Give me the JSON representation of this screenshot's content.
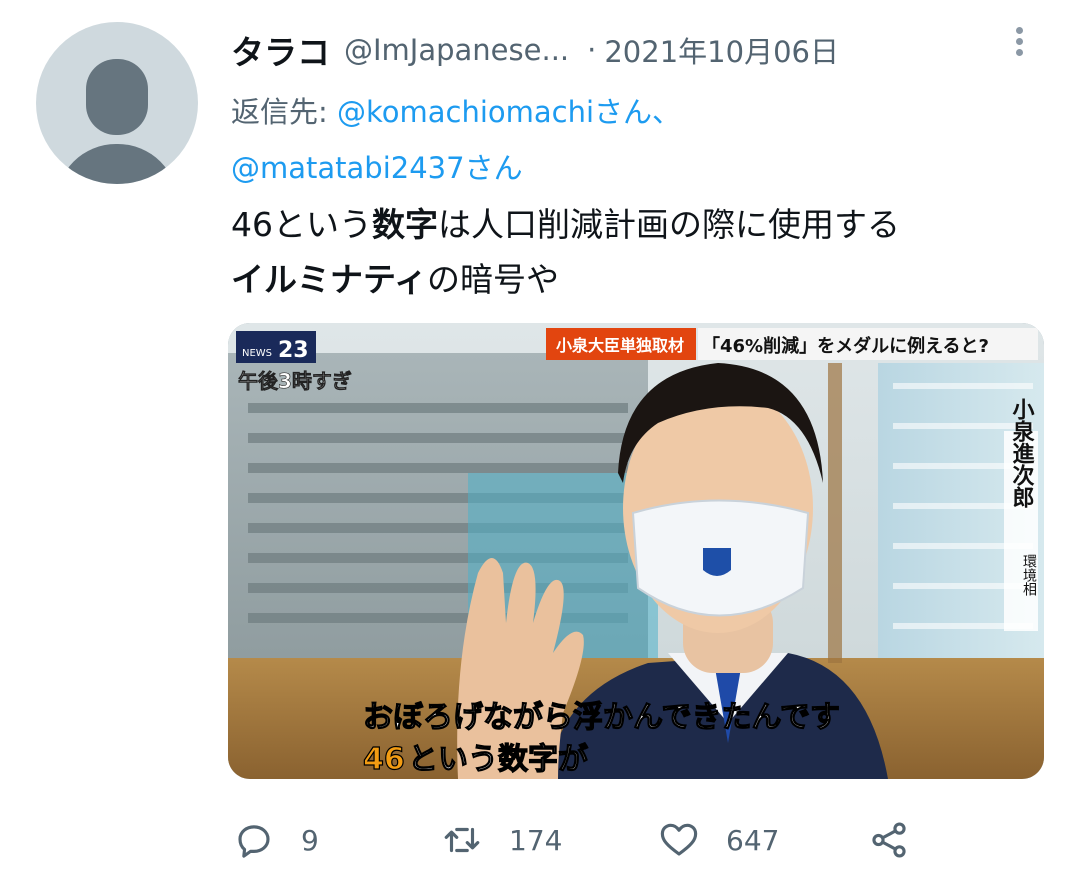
{
  "tweet": {
    "display_name": "タラコ",
    "handle": "@ImJapanese...",
    "separator": "·",
    "date": "2021年10月06日",
    "reply_label": "返信先:",
    "reply_to_1": "@komachiomachiさん、",
    "reply_to_2": "@matatabi2437さん",
    "text_part1": "46という",
    "text_bold1": "数字",
    "text_part2": "は人口削減計画の際に使用する",
    "text_bold2": "イルミナティ",
    "text_part3": "の暗号や"
  },
  "media": {
    "logo_small": "NEWS",
    "logo_number": "23",
    "time_label": "午後3時すぎ",
    "tag": "小泉大臣単独取材",
    "headline": "「46%削減」をメダルに例えると?",
    "person_name": "小泉進次郎",
    "person_title": "環境相",
    "caption_line1": "おぼろげながら浮かんできたんです",
    "caption_number": "46",
    "caption_line2_rest": "という数字が"
  },
  "actions": {
    "replies": "9",
    "retweets": "174",
    "likes": "647"
  },
  "icons": {
    "more": "more-vertical-icon",
    "reply": "reply-icon",
    "retweet": "retweet-icon",
    "like": "heart-icon",
    "share": "share-icon"
  },
  "colors": {
    "link": "#1d9bf0",
    "secondary": "#536471",
    "caption_highlight": "#f39c12"
  }
}
